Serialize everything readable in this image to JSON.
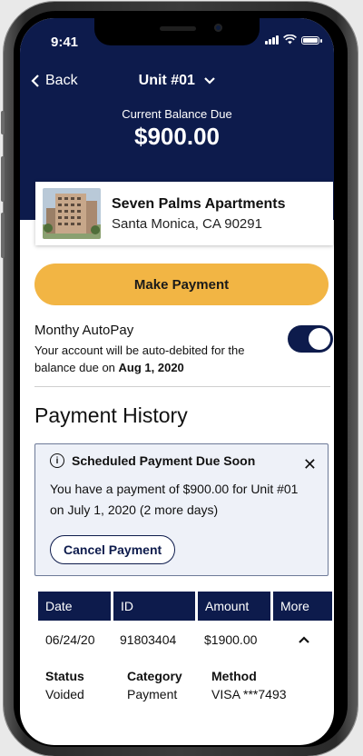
{
  "status_bar": {
    "time": "9:41"
  },
  "nav": {
    "back_label": "Back",
    "unit_label": "Unit #01"
  },
  "balance": {
    "label": "Current Balance Due",
    "amount": "$900.00"
  },
  "property": {
    "name": "Seven Palms Apartments",
    "address": "Santa Monica, CA 90291"
  },
  "actions": {
    "make_payment_label": "Make Payment"
  },
  "autopay": {
    "title": "Monthy AutoPay",
    "description_prefix": "Your account will be auto-debited for the balance due on ",
    "due_date": "Aug 1, 2020",
    "enabled": true
  },
  "payment_history": {
    "title": "Payment History",
    "notice": {
      "title": "Scheduled Payment Due Soon",
      "body": "You have a payment of $900.00 for Unit #01 on July 1, 2020 (2 more days)",
      "cancel_label": "Cancel Payment"
    },
    "columns": [
      "Date",
      "ID",
      "Amount",
      "More"
    ],
    "rows": [
      {
        "date": "06/24/20",
        "id": "91803404",
        "amount": "$1900.00",
        "expanded": true,
        "status_label": "Status",
        "status": "Voided",
        "category_label": "Category",
        "category": "Payment",
        "method_label": "Method",
        "method": "VISA ***7493"
      }
    ]
  },
  "colors": {
    "navy": "#0d1b4c",
    "accent": "#f2b544",
    "notice_bg": "#eef1f8"
  }
}
